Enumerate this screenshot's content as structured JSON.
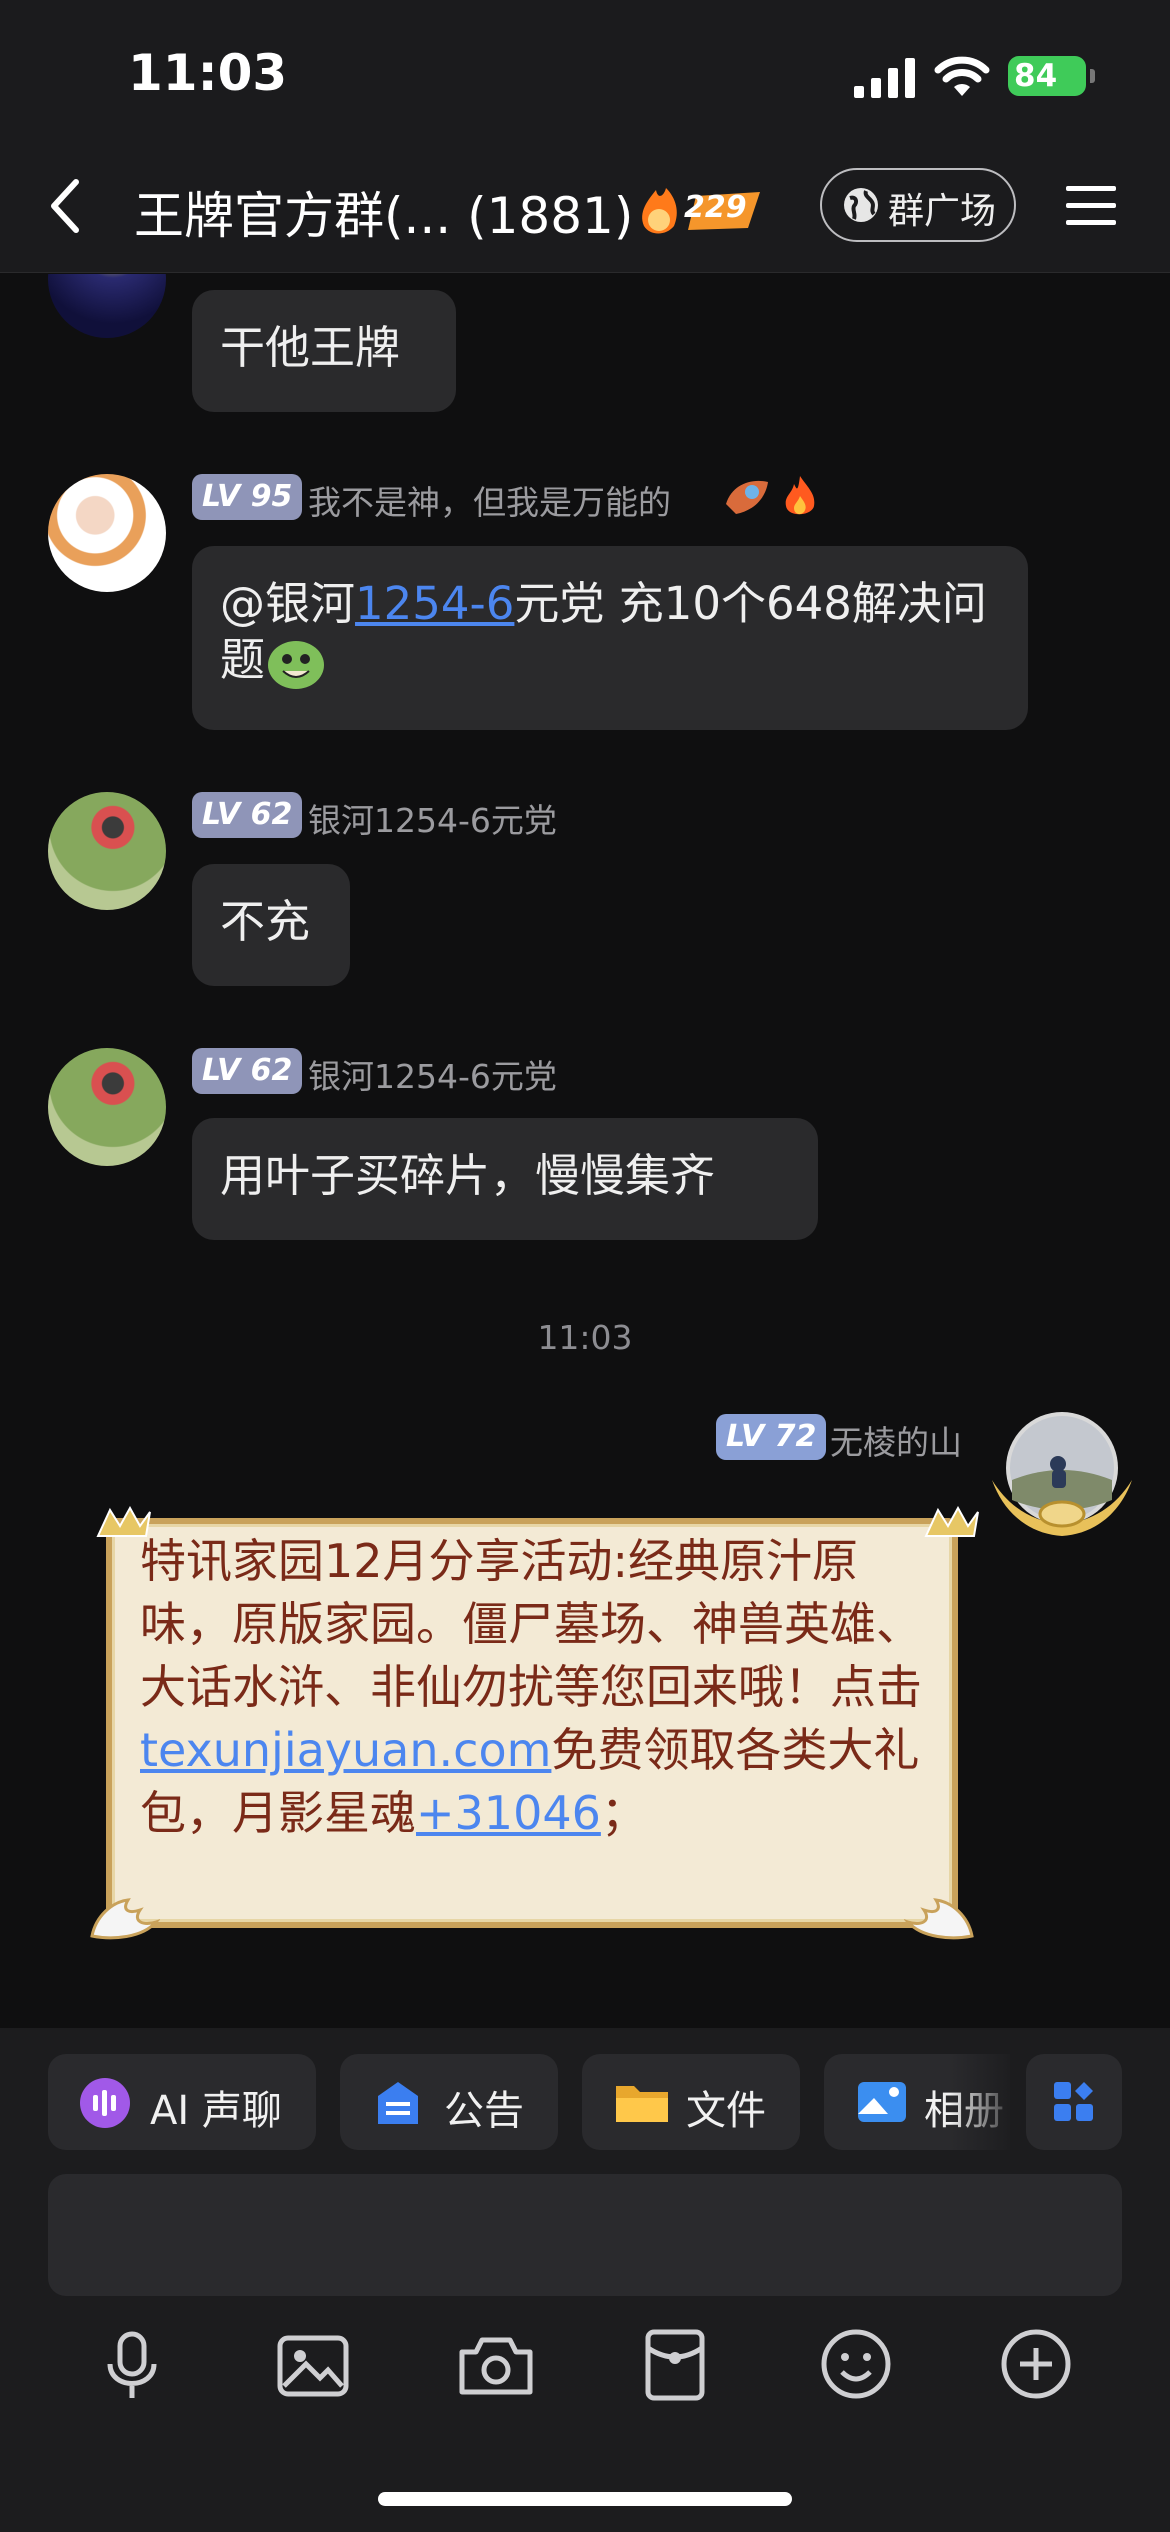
{
  "status_bar": {
    "time": "11:03",
    "battery": "84"
  },
  "header": {
    "title": "王牌官方群(... (1881)",
    "fire_count": "229",
    "square_button": "群广场"
  },
  "messages": [
    {
      "text": "干他王牌"
    },
    {
      "level": "LV 95",
      "nickname": "我不是神，但我是万能的",
      "text_prefix": "@银河",
      "link": "1254-6",
      "text_suffix": "元党 充10个648解决问题"
    },
    {
      "level": "LV 62",
      "nickname": "银河1254-6元党",
      "text": "不充"
    },
    {
      "level": "LV 62",
      "nickname": "银河1254-6元党",
      "text": "用叶子买碎片，慢慢集齐"
    }
  ],
  "timestamp": "11:03",
  "my_message": {
    "level": "LV 72",
    "nickname": "无棱的山",
    "text_1": "特讯家园12月分享活动:经典原汁原味，原版家园。僵尸墓场、神兽英雄、大话水浒、非仙勿扰等您回来哦！点击",
    "link_1": "texunjiayuan.com",
    "text_2": "免费领取各类大礼包，月影星魂",
    "link_2": "+31046",
    "text_3": "；"
  },
  "toolbar": {
    "chips": [
      {
        "label": "AI 声聊"
      },
      {
        "label": "公告"
      },
      {
        "label": "文件"
      },
      {
        "label": "相册"
      }
    ]
  },
  "colors": {
    "link": "#4c86ef",
    "level_badge": "#8f95b8",
    "background": "#0f0f10"
  }
}
